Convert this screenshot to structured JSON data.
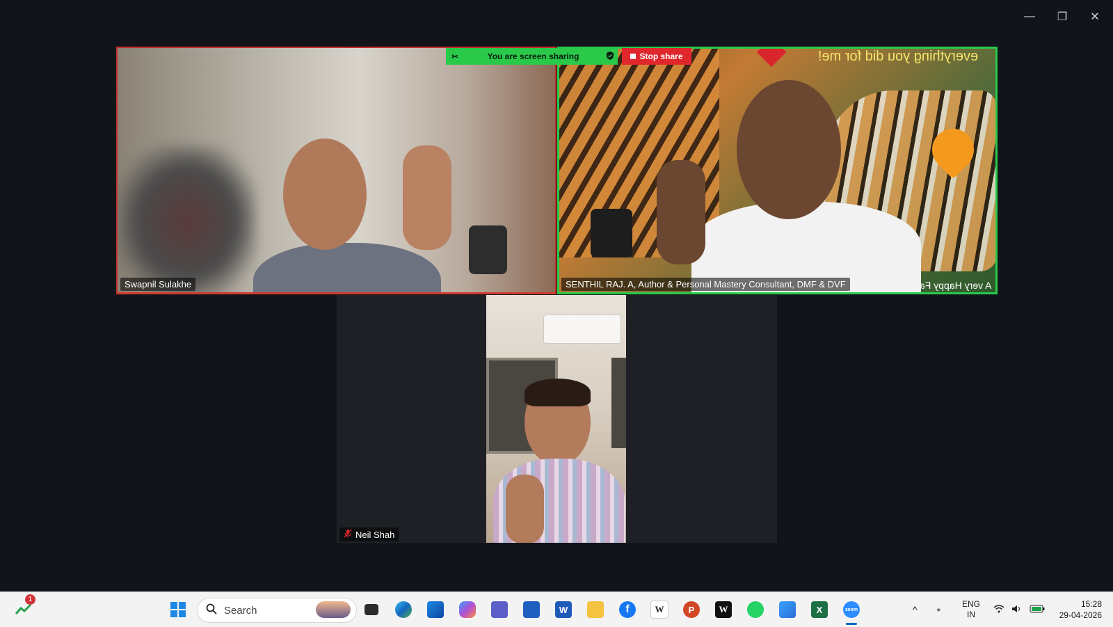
{
  "window_controls": {
    "minimize": "—",
    "restore": "❐",
    "close": "✕"
  },
  "share_banner": {
    "text": "You are screen sharing",
    "stop_label": "Stop share"
  },
  "participants": [
    {
      "name": "Swapnil Sulakhe"
    },
    {
      "name": "SENTHIL RAJ. A, Author & Personal Mastery Consultant, DMF & DVF",
      "bg_text_top": "everything you did for me!",
      "bg_text_bottom": "A very Happy Fa"
    },
    {
      "name": "Neil Shah",
      "muted": true
    }
  ],
  "taskbar": {
    "stocks_badge": "1",
    "search_placeholder": "Search",
    "apps": [
      "windows-start",
      "search",
      "task-view",
      "edge",
      "outlook",
      "copilot",
      "teams",
      "store",
      "word",
      "file-explorer",
      "facebook",
      "wikipedia",
      "powerpoint",
      "wikipedia-w",
      "whatsapp",
      "photos",
      "excel",
      "zoom"
    ],
    "word_glyph": "W",
    "powerpoint_glyph": "P",
    "excel_glyph": "X",
    "facebook_glyph": "f",
    "wiki_glyph": "W",
    "wiki2_glyph": "W",
    "zoom_glyph": "zoom",
    "language": "ENG",
    "region": "IN",
    "time": "15:28",
    "date": "29-04-2026"
  },
  "colors": {
    "accent_green": "#2ac94a",
    "stop_red": "#e0272c",
    "meeting_bg": "#11151b"
  }
}
